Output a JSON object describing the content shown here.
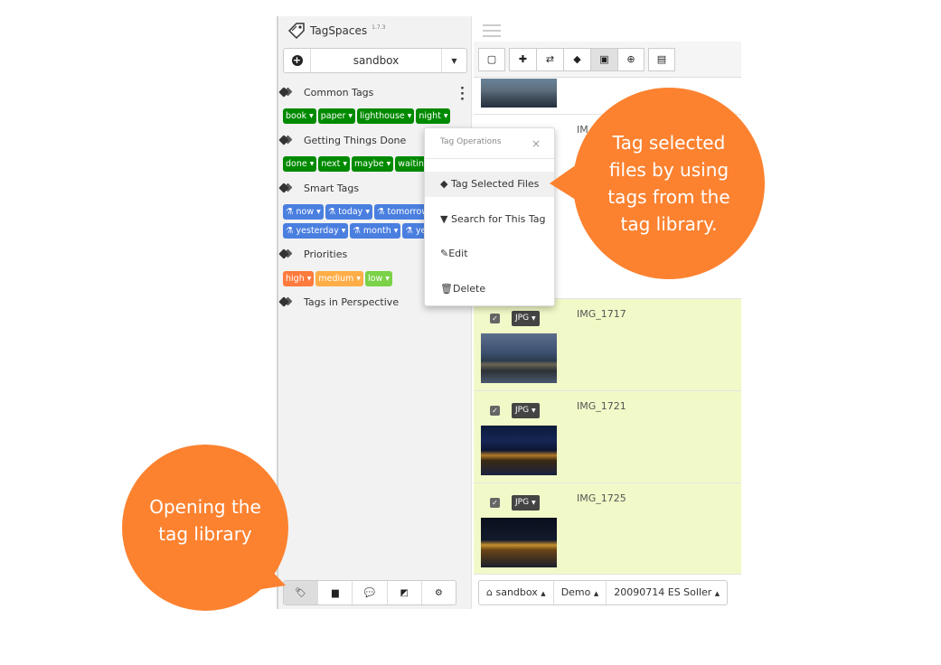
{
  "app": {
    "name": "TagSpaces",
    "version": "1.7.3"
  },
  "location": {
    "current": "sandbox"
  },
  "tag_groups": [
    {
      "name": "Common Tags",
      "tags": [
        {
          "label": "book",
          "color": "#008a00"
        },
        {
          "label": "paper",
          "color": "#008a00"
        },
        {
          "label": "lighthouse",
          "color": "#008a00"
        },
        {
          "label": "night",
          "color": "#008a00"
        }
      ]
    },
    {
      "name": "Getting Things Done",
      "tags": [
        {
          "label": "done",
          "color": "#008a00"
        },
        {
          "label": "next",
          "color": "#008a00"
        },
        {
          "label": "maybe",
          "color": "#008a00"
        },
        {
          "label": "waiting",
          "color": "#008a00"
        }
      ]
    },
    {
      "name": "Smart Tags",
      "tags": [
        {
          "label": "now",
          "color": "#4a7fe0"
        },
        {
          "label": "today",
          "color": "#4a7fe0"
        },
        {
          "label": "tomorrow",
          "color": "#4a7fe0"
        },
        {
          "label": "yesterday",
          "color": "#4a7fe0"
        },
        {
          "label": "month",
          "color": "#4a7fe0"
        },
        {
          "label": "year",
          "color": "#4a7fe0"
        }
      ]
    },
    {
      "name": "Priorities",
      "tags": [
        {
          "label": "high",
          "color": "#ff7a3d"
        },
        {
          "label": "medium",
          "color": "#ffad46"
        },
        {
          "label": "low",
          "color": "#7bd148"
        }
      ]
    },
    {
      "name": "Tags in Perspective",
      "tags": []
    }
  ],
  "tag_menu": {
    "title": "Tag Operations",
    "close": "×",
    "items": [
      {
        "label": "Tag Selected Files",
        "icon": "tag-icon"
      },
      {
        "label": "Search for This Tag",
        "icon": "filter-icon"
      },
      {
        "label": "Edit",
        "icon": "pencil-icon"
      },
      {
        "label": "Delete",
        "icon": "trash-icon"
      }
    ]
  },
  "files": [
    {
      "name": "IM",
      "selected": false
    },
    {
      "name": "IMG_1717",
      "ext": "JPG",
      "selected": true
    },
    {
      "name": "IMG_1721",
      "ext": "JPG",
      "selected": true
    },
    {
      "name": "IMG_1725",
      "ext": "JPG",
      "selected": true
    }
  ],
  "status_bar": {
    "location": "sandbox",
    "folder1": "Demo",
    "folder2": "20090714 ES Soller"
  },
  "callouts": {
    "tag_selected": "Tag selected files by using tags from the tag library.",
    "open_library": "Opening the tag library"
  },
  "colors": {
    "accent": "#fc8230",
    "selected_row": "#f2f9c8",
    "tag_green": "#008a00",
    "tag_blue": "#4a7fe0"
  }
}
